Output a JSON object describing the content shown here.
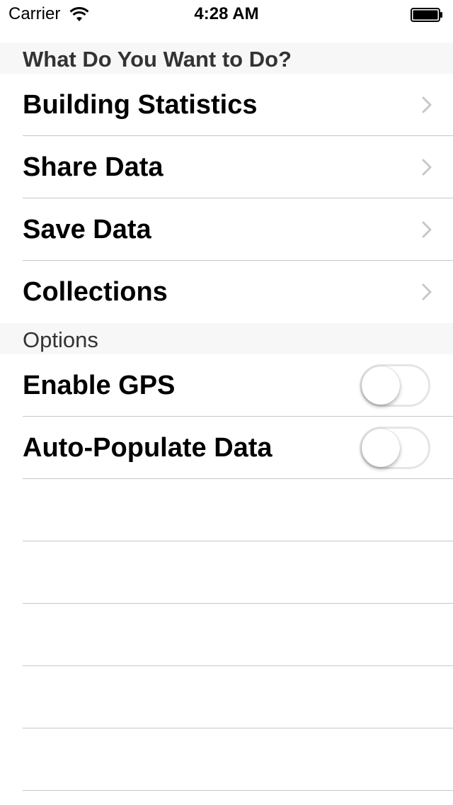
{
  "status_bar": {
    "carrier": "Carrier",
    "time": "4:28 AM",
    "wifi_icon": "wifi-icon",
    "battery_icon": "battery-icon"
  },
  "sections": [
    {
      "header": "What Do You Want to Do?",
      "rows": [
        {
          "label": "Building Statistics",
          "accessory": "chevron-right-icon"
        },
        {
          "label": "Share Data",
          "accessory": "chevron-right-icon"
        },
        {
          "label": "Save Data",
          "accessory": "chevron-right-icon"
        },
        {
          "label": "Collections",
          "accessory": "chevron-right-icon"
        }
      ]
    },
    {
      "header": "Options",
      "rows": [
        {
          "label": "Enable GPS",
          "toggle_on": false
        },
        {
          "label": "Auto-Populate Data",
          "toggle_on": false
        }
      ]
    }
  ],
  "colors": {
    "background": "#ffffff",
    "section_header_bg": "#f7f7f7",
    "separator": "#c8c7cc",
    "chevron": "#c7c7cc",
    "toggle_border": "#e5e5e5"
  }
}
